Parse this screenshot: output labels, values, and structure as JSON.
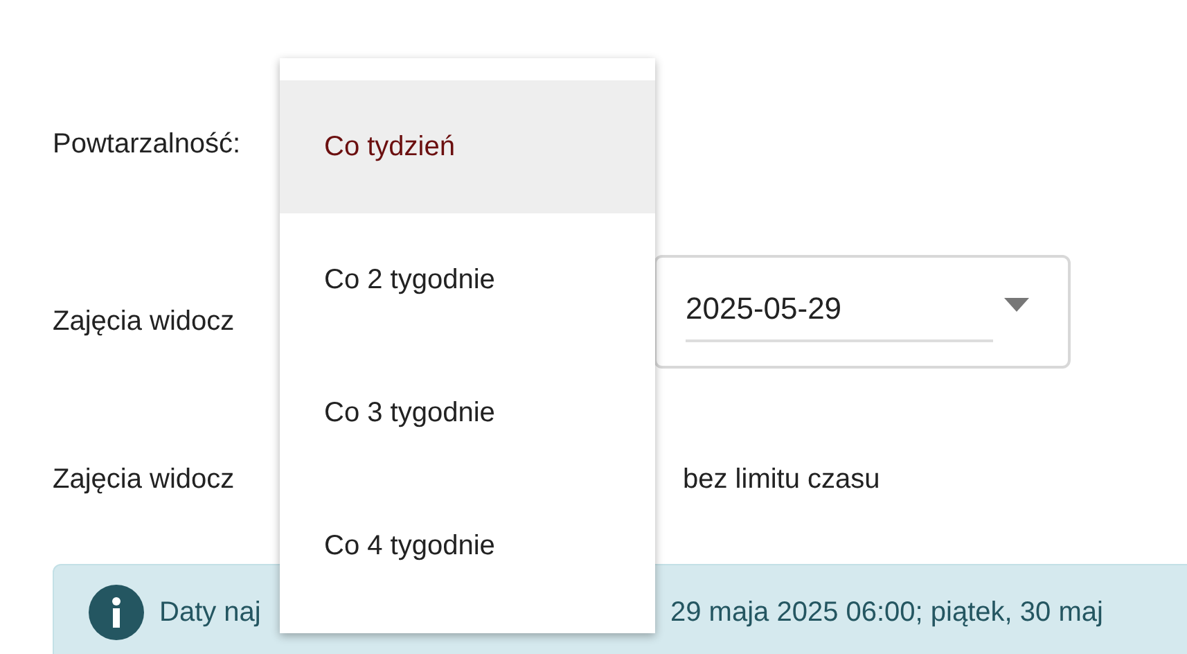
{
  "form": {
    "recurrence_label": "Powtarzalność:",
    "visible_from_label": "Zajęcia widocz",
    "visible_from_date": "2025-05-29",
    "visible_to_label": "Zajęcia widocz",
    "visible_to_option": "bez limitu czasu"
  },
  "info": {
    "text_start": "Daty naj",
    "text_end": "29 maja 2025 06:00; piątek, 30 maj"
  },
  "menu": {
    "items": [
      {
        "label": "Co tydzień",
        "selected": true
      },
      {
        "label": "Co 2 tygodnie",
        "selected": false
      },
      {
        "label": "Co 3 tygodnie",
        "selected": false
      },
      {
        "label": "Co 4 tygodnie",
        "selected": false
      }
    ]
  }
}
